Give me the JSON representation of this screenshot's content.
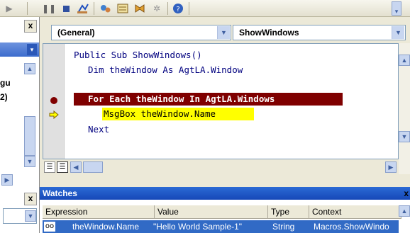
{
  "toolbar": {
    "buttons": [
      "play-icon",
      "pause-icon",
      "stop-icon",
      "design-mode-icon",
      "project-explorer-icon",
      "properties-icon",
      "object-browser-icon",
      "toolbox-icon",
      "help-icon"
    ]
  },
  "project_pane": {
    "partial_text_1": "gu",
    "partial_text_2": "2)",
    "close_label": "x"
  },
  "code_window": {
    "object_combo": "(General)",
    "procedure_combo": "ShowWindows",
    "lines": [
      {
        "text": "Public Sub ShowWindows()"
      },
      {
        "text": "Dim theWindow As AgtLA.Window"
      },
      {
        "text": ""
      },
      {
        "text": "For Each theWindow In AgtLA.Windows"
      },
      {
        "text": "MsgBox theWindow.Name"
      },
      {
        "text": "Next"
      }
    ]
  },
  "watches": {
    "title": "Watches",
    "close_label": "x",
    "columns": [
      "Expression",
      "Value",
      "Type",
      "Context"
    ],
    "row": {
      "expression": "theWindow.Name",
      "value": "\"Hello World Sample-1\"",
      "type": "String",
      "context": "Macros.ShowWindo"
    }
  },
  "colors": {
    "breakpoint": "#7f0000",
    "execution": "#ffff00",
    "selection": "#316ac5",
    "watch_title": "#1648b8"
  }
}
